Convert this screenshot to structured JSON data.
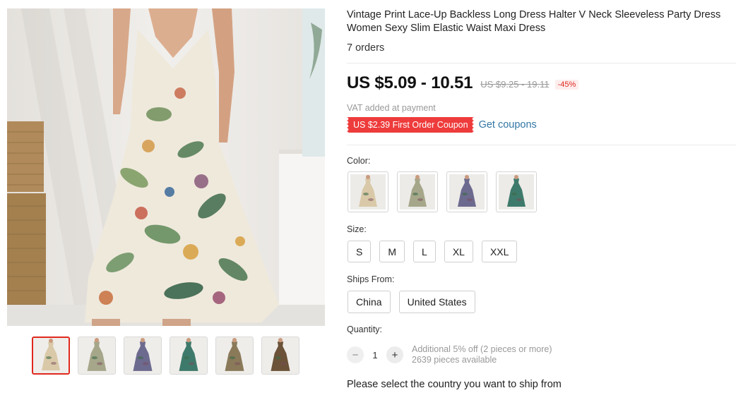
{
  "product": {
    "title": "Vintage Print Lace-Up Backless Long Dress Halter V Neck Sleeveless Party Dress Women Sexy Slim Elastic Waist Maxi Dress",
    "orders": "7 orders"
  },
  "pricing": {
    "price": "US $5.09 - 10.51",
    "original_price": "US $9.25 - 19.11",
    "discount": "-45%",
    "vat_note": "VAT added at payment",
    "coupon": "US $2.39 First Order Coupon",
    "get_coupons": "Get coupons"
  },
  "color": {
    "label": "Color:",
    "options": [
      {
        "name": "floral-white",
        "color": "#d9c9a8"
      },
      {
        "name": "floral-green",
        "color": "#a6a78a"
      },
      {
        "name": "floral-purple",
        "color": "#6d6a8f"
      },
      {
        "name": "floral-teal",
        "color": "#3e7a6b"
      }
    ]
  },
  "size": {
    "label": "Size:",
    "options": [
      "S",
      "M",
      "L",
      "XL",
      "XXL"
    ]
  },
  "ships_from": {
    "label": "Ships From:",
    "options": [
      "China",
      "United States"
    ]
  },
  "quantity": {
    "label": "Quantity:",
    "value": "1",
    "minus_icon": "minus-icon",
    "plus_icon": "plus-icon",
    "note_discount": "Additional 5% off (2 pieces or more)",
    "note_stock": "2639 pieces available"
  },
  "shipping_message": "Please select the country you want to ship from",
  "gallery": {
    "thumbnails": [
      {
        "name": "thumb-1",
        "color": "#d9c9a8",
        "active": true
      },
      {
        "name": "thumb-2",
        "color": "#a6a78a",
        "active": false
      },
      {
        "name": "thumb-3",
        "color": "#6d6a8f",
        "active": false
      },
      {
        "name": "thumb-4",
        "color": "#3e7a6b",
        "active": false
      },
      {
        "name": "thumb-5",
        "color": "#8a7a5a",
        "active": false
      },
      {
        "name": "thumb-6",
        "color": "#6b5238",
        "active": false
      }
    ],
    "colors": {
      "wall": "#efedea",
      "accent": "#e0281e",
      "coupon": "#ee3b3b",
      "link": "#3276a4"
    }
  }
}
